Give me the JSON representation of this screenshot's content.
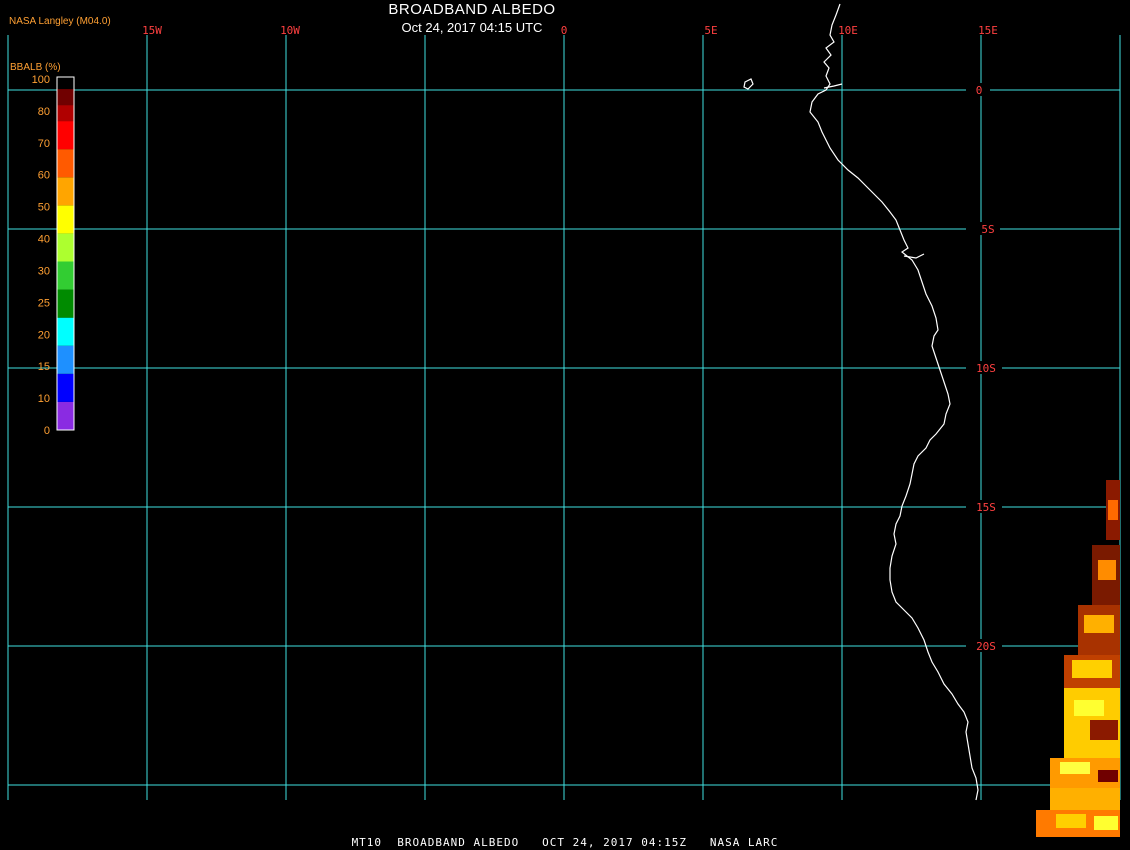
{
  "header": {
    "credit": "NASA Langley (M04.0)",
    "title": "BROADBAND ALBEDO",
    "datetime": "Oct 24, 2017 04:15 UTC"
  },
  "colorbar": {
    "label": "BBALB (%)",
    "ticks": [
      "0",
      "10",
      "15",
      "20",
      "25",
      "30",
      "40",
      "50",
      "60",
      "70",
      "80",
      "100"
    ],
    "colors": [
      "#8a2be2",
      "#0000ff",
      "#1e90ff",
      "#00ffff",
      "#008b00",
      "#32cd32",
      "#adff2f",
      "#ffff00",
      "#ffa500",
      "#ff5a00",
      "#ff0000",
      "#b00000",
      "#700000"
    ],
    "outline_color": "#ffffff"
  },
  "grid": {
    "color": "#40e0e0",
    "label_color": "#ff4040",
    "lon_labels": [
      "15W",
      "10W",
      "0",
      "5E",
      "10E",
      "15E"
    ],
    "lat_labels": [
      "0",
      "5S",
      "10S",
      "15S",
      "20S"
    ]
  },
  "coastline_color": "#ffffff",
  "footer": {
    "text": "MT10  BROADBAND ALBEDO   OCT 24, 2017 04:15Z   NASA LARC"
  }
}
